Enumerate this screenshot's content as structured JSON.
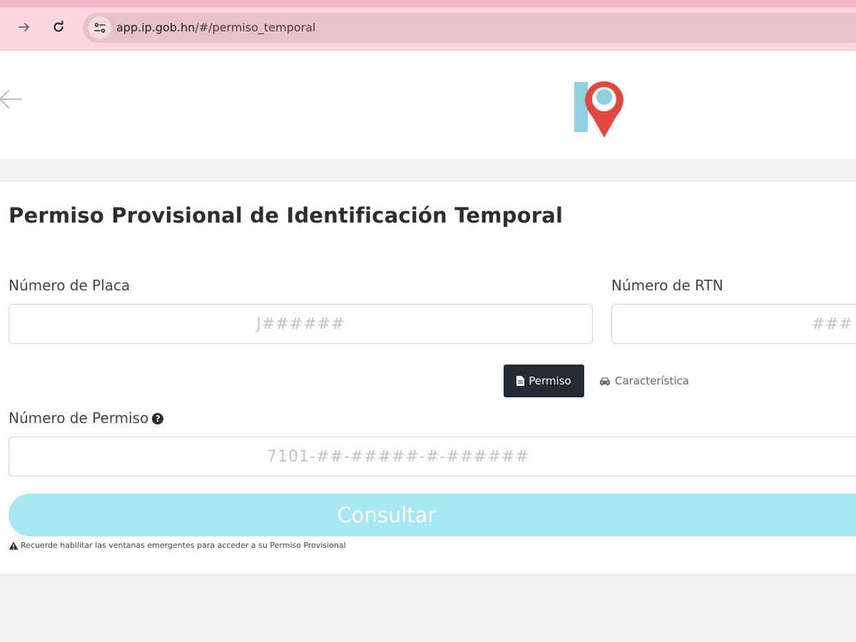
{
  "browser": {
    "url_host": "app.ip.gob.hn",
    "url_path": "/#/permiso_temporal"
  },
  "page": {
    "title": "Permiso Provisional de Identificación Temporal"
  },
  "form": {
    "placa": {
      "label": "Número de Placa",
      "placeholder": "J######",
      "value": ""
    },
    "rtn": {
      "label": "Número de RTN",
      "placeholder": "###",
      "value": ""
    },
    "tabs": [
      {
        "label": "Permiso",
        "icon": "file-icon",
        "active": true
      },
      {
        "label": "Característica",
        "icon": "car-icon",
        "active": false
      }
    ],
    "permiso": {
      "label": "Número de Permiso",
      "placeholder": "7101-##-#####-#-######",
      "value": ""
    },
    "submit_label": "Consultar",
    "note": "Recuerde habilitar las ventanas emergentes para acceder a su Permiso Provisional"
  },
  "colors": {
    "chrome_pink": "#f7b6c4",
    "button_cyan": "#a8e8f3",
    "tab_active_bg": "#252a32",
    "logo_red": "#e2483d",
    "logo_blue": "#8fd1e2"
  }
}
